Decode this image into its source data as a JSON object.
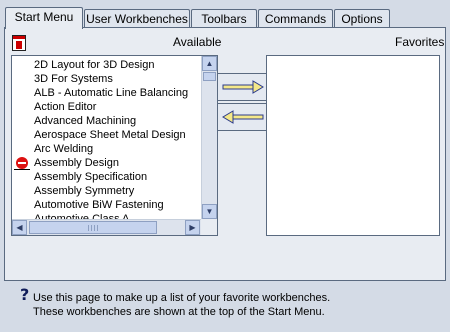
{
  "tabs": [
    {
      "label": "Start Menu",
      "active": true
    },
    {
      "label": "User Workbenches",
      "active": false
    },
    {
      "label": "Toolbars",
      "active": false
    },
    {
      "label": "Commands",
      "active": false
    },
    {
      "label": "Options",
      "active": false
    }
  ],
  "available": {
    "label": "Available",
    "items": [
      "2D Layout for 3D Design",
      "3D For Systems",
      "ALB - Automatic Line Balancing",
      "Action Editor",
      "Advanced Machining",
      "Aerospace Sheet Metal  Design",
      "Arc Welding",
      "Assembly Design",
      "Assembly Specification",
      "Assembly Symmetry",
      "Automotive BiW Fastening",
      "Automotive Class A"
    ],
    "icon_item_index": 7,
    "icon_item_icon": "stop-icon"
  },
  "favorites": {
    "label": "Favorites",
    "items": []
  },
  "buttons": {
    "add_icon": "arrow-right-icon",
    "remove_icon": "arrow-left-icon"
  },
  "help": {
    "icon": "question-icon",
    "line1": "Use this page to make up a list of your favorite workbenches.",
    "line2": "These workbenches are shown at the top of the Start Menu."
  }
}
